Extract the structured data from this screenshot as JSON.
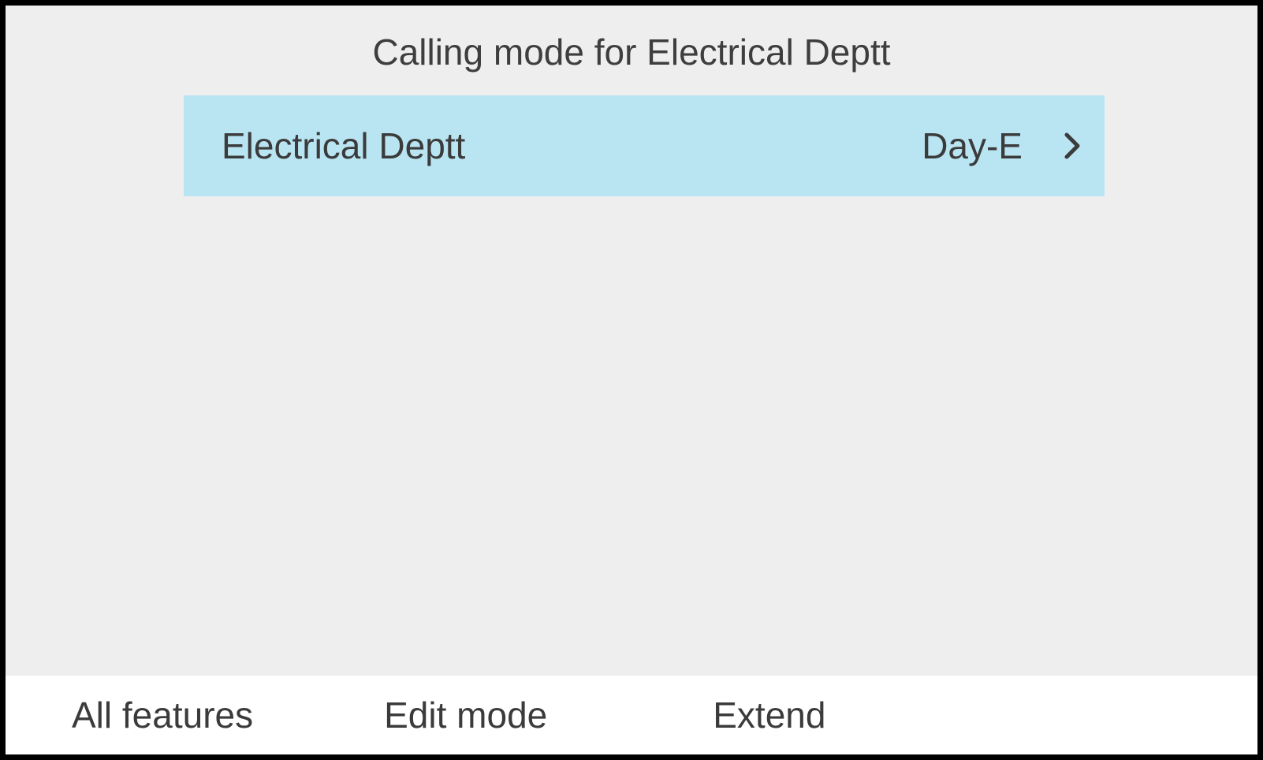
{
  "header": {
    "title": "Calling mode for Electrical Deptt"
  },
  "list": {
    "items": [
      {
        "label": "Electrical Deptt",
        "value": "Day-E"
      }
    ]
  },
  "footer": {
    "items": [
      {
        "label": "All features"
      },
      {
        "label": "Edit mode"
      },
      {
        "label": "Extend"
      }
    ]
  },
  "colors": {
    "row_highlight": "#b9e5f3",
    "background": "#eeeeee",
    "footer_bg": "#ffffff",
    "text": "#3b3b3b"
  }
}
